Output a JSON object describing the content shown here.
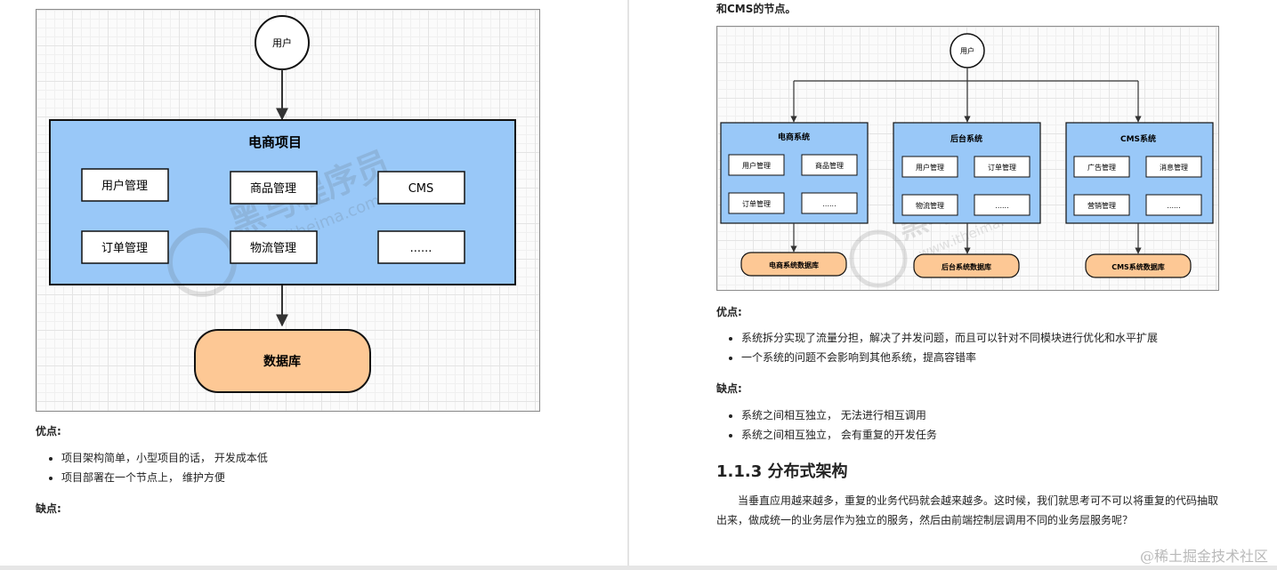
{
  "left": {
    "diagram": {
      "user": "用户",
      "project_title": "电商项目",
      "modules": [
        "用户管理",
        "商品管理",
        "CMS",
        "订单管理",
        "物流管理",
        "......"
      ],
      "database": "数据库",
      "watermark": {
        "cn": "黑马程序员",
        "url": "www.itheima.com"
      }
    },
    "pros_label": "优点:",
    "pros": [
      "项目架构简单，小型项目的话， 开发成本低",
      "项目部署在一个节点上， 维护方便"
    ],
    "cons_label": "缺点:"
  },
  "right": {
    "intro_tail": "和CMS的节点。",
    "diagram": {
      "user": "用户",
      "systems": [
        {
          "title": "电商系统",
          "modules": [
            "用户管理",
            "商品管理",
            "订单管理",
            "......"
          ],
          "db": "电商系统数据库"
        },
        {
          "title": "后台系统",
          "modules": [
            "用户管理",
            "订单管理",
            "物流管理",
            "......"
          ],
          "db": "后台系统数据库"
        },
        {
          "title": "CMS系统",
          "modules": [
            "广告管理",
            "消息管理",
            "营销管理",
            "......"
          ],
          "db": "CMS系统数据库"
        }
      ],
      "watermark": {
        "cn": "黑马程序员",
        "url": "www.itheima.com"
      }
    },
    "pros_label": "优点:",
    "pros": [
      "系统拆分实现了流量分担，解决了并发问题，而且可以针对不同模块进行优化和水平扩展",
      "一个系统的问题不会影响到其他系统，提高容错率"
    ],
    "cons_label": "缺点:",
    "cons": [
      "系统之间相互独立， 无法进行相互调用",
      "系统之间相互独立， 会有重复的开发任务"
    ],
    "section_title": "1.1.3 分布式架构",
    "paragraph": "当垂直应用越来越多，重复的业务代码就会越来越多。这时候，我们就思考可不可以将重复的代码抽取出来，做成统一的业务层作为独立的服务，然后由前端控制层调用不同的业务层服务呢？"
  },
  "footer": "@稀土掘金技术社区",
  "colors": {
    "box_blue": "#99c8f8",
    "db_orange": "#fdc895",
    "border": "#111111",
    "arrow": "#333333"
  }
}
